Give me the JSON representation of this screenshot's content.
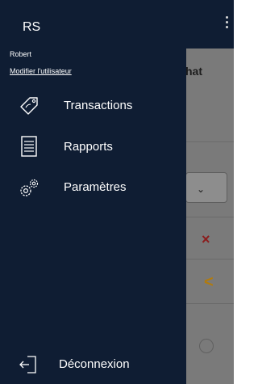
{
  "drawer": {
    "initials": "RS",
    "user_name": "Robert",
    "edit_user_link": "Modifier l'utilisateur",
    "items": [
      {
        "label": "Transactions",
        "icon": "tag-icon"
      },
      {
        "label": "Rapports",
        "icon": "document-icon"
      },
      {
        "label": "Paramètres",
        "icon": "gears-icon"
      }
    ],
    "logout_label": "Déconnexion"
  },
  "background": {
    "title_fragment": "hat",
    "select_chevron": "⌄",
    "remove_symbol": "×",
    "back_symbol": "<"
  },
  "colors": {
    "drawer_bg": "#0f1d33",
    "overlay": "#7a7a7a",
    "remove": "#8b1d1d",
    "back": "#b07b10"
  }
}
